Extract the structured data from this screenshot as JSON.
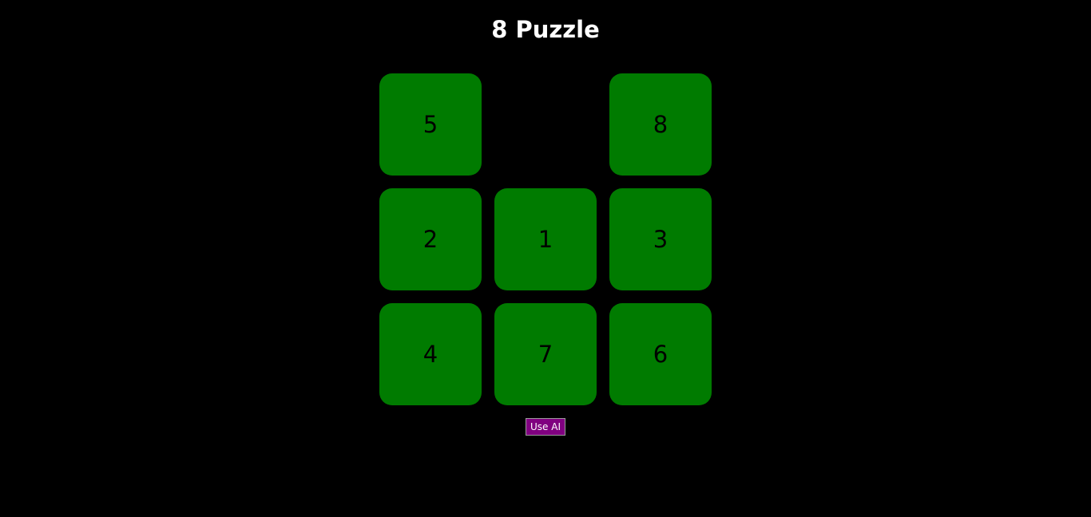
{
  "title": "8 Puzzle",
  "colors": {
    "background": "#000000",
    "tile": "#007b00",
    "tile_text": "#000000",
    "button": "#800080"
  },
  "board": {
    "tiles": [
      "5",
      "",
      "8",
      "2",
      "1",
      "3",
      "4",
      "7",
      "6"
    ]
  },
  "button": {
    "label": "Use AI"
  }
}
